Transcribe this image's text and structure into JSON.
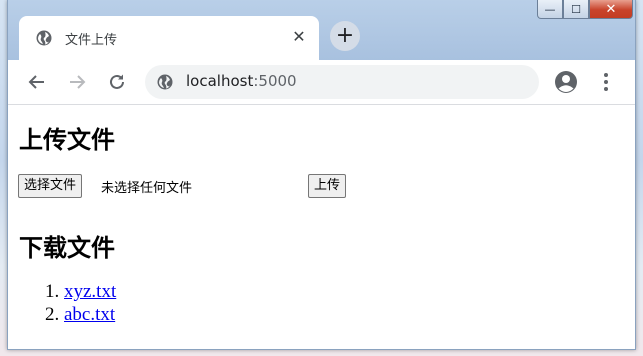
{
  "browser": {
    "tab_title": "文件上传",
    "tab_close": "✕",
    "new_tab": "+",
    "url_host": "localhost",
    "url_port": ":5000",
    "window_controls": {
      "minimize": "—",
      "maximize": "☐",
      "close": "✕"
    }
  },
  "icons": {
    "favicon": "globe-icon",
    "back": "arrow-left-icon",
    "forward": "arrow-right-icon",
    "reload": "reload-icon",
    "site_info": "globe-icon",
    "profile": "account-circle-icon",
    "menu": "kebab-menu-icon"
  },
  "colors": {
    "link": "#0000ee",
    "tab_bg": "#ffffff",
    "omnibox_bg": "#f1f3f4"
  },
  "upload": {
    "heading": "上传文件",
    "choose_file_label": "选择文件",
    "no_file_text": "未选择任何文件",
    "submit_label": "上传"
  },
  "download": {
    "heading": "下载文件",
    "files": [
      "xyz.txt",
      "abc.txt"
    ]
  }
}
